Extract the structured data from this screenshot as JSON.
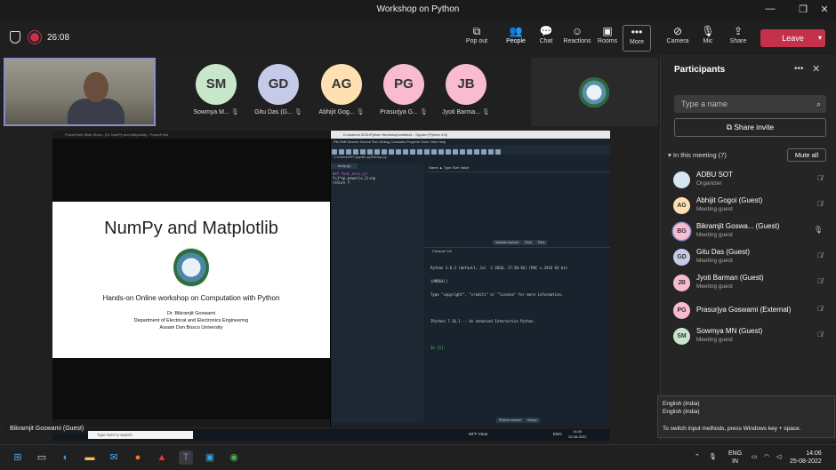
{
  "window": {
    "title": "Workshop on Python",
    "controls": [
      "—",
      "❐",
      "✕"
    ]
  },
  "toolbar": {
    "timer": "26:08",
    "buttons": [
      {
        "label": "Pop out",
        "icon": "popout-icon",
        "glyph": "⧉"
      },
      {
        "label": "People",
        "icon": "people-icon",
        "glyph": "👥"
      },
      {
        "label": "Chat",
        "icon": "chat-icon",
        "glyph": "💬"
      },
      {
        "label": "Reactions",
        "icon": "reactions-icon",
        "glyph": "☺"
      },
      {
        "label": "Rooms",
        "icon": "rooms-icon",
        "glyph": "▣"
      },
      {
        "label": "More",
        "icon": "more-icon",
        "glyph": "•••"
      },
      {
        "label": "Camera",
        "icon": "camera-off-icon",
        "glyph": "⊘"
      },
      {
        "label": "Mic",
        "icon": "mic-off-icon",
        "glyph": "🎙"
      },
      {
        "label": "Share",
        "icon": "share-icon",
        "glyph": "⇪"
      }
    ],
    "leave_label": "Leave",
    "leave_color": "#c4314b"
  },
  "gallery": [
    {
      "initials": "SM",
      "name": "Sowmya M...",
      "color": "#c8e6c9"
    },
    {
      "initials": "GD",
      "name": "Gitu Das (G...",
      "color": "#c5cae9"
    },
    {
      "initials": "AG",
      "name": "Abhijit Gog...",
      "color": "#ffe0b2"
    },
    {
      "initials": "PG",
      "name": "Prasurjya G...",
      "color": "#f8bbd0"
    },
    {
      "initials": "JB",
      "name": "Jyoti Barma...",
      "color": "#f8bbd0"
    }
  ],
  "presenter_label": "Bikramjit Goswami (Guest)",
  "shared": {
    "ppt_title": "PowerPoint Slide Show - [01 NumPy and Matplotlib] - PowerPoint",
    "slide": {
      "title": "NumPy and Matplotlib",
      "subtitle": "Hands-on Online workshop on Computation with Python",
      "author_1": "Dr. Bikramjit Goswami",
      "author_2": "Department of Electrical and Electronics Engineering",
      "author_3": "Assam Don Bosco University"
    },
    "spyder_title": "D:\\Autumn 2021\\Python Workshop\\untitled1 - Spyder (Python 3.8)",
    "spyder_menu": "File  Edit  Search  Source  Run  Debug  Consoles  Projects  Tools  View  Help",
    "spyder_path": "C:\\Users\\HP\\.spyder-py3\\temp.py",
    "editor_tab": "temp.py",
    "code_1": "def func_ex(x,y):",
    "code_2": "    f=1*np.power(x,2)+np",
    "code_3": "    return f",
    "var_headers": "Name ▲   Type    Size                         Value",
    "var_tabs": [
      "Variable explorer",
      "Plots",
      "Files"
    ],
    "console_tab": "Console 1/A",
    "console_1": "Python 3.8.3 (default, Jul  2 2020, 17:30:36) [MSC v.1916 64 bit",
    "console_2": "(AMD64)]",
    "console_3": "Type \"copyright\", \"credits\" or \"license\" for more information.",
    "console_4": "IPython 7.16.1 -- An enhanced Interactive Python.",
    "console_prompt": "In [1]:",
    "console_tabs": [
      "IPython console",
      "History"
    ],
    "rdp_search": "Type here to search",
    "rdp_weather": "69°F  Clear",
    "rdp_lang": "ENG",
    "rdp_time": "14:06",
    "rdp_date": "25-08-2022"
  },
  "panel": {
    "title": "Participants",
    "search_placeholder": "Type a name",
    "share_invite": "Share invite",
    "in_meeting": "In this meeting (7)",
    "mute_all": "Mute all",
    "participants": [
      {
        "initials": "",
        "name": "ADBU SOT",
        "role": "Organizer",
        "color": "#d7e7f2",
        "mic": "muted"
      },
      {
        "initials": "AG",
        "name": "Abhijit Gogoi (Guest)",
        "role": "Meeting guest",
        "color": "#ffe0b2",
        "mic": "muted"
      },
      {
        "initials": "BG",
        "name": "Bikramjit Goswa... (Guest)",
        "role": "Meeting guest",
        "color": "#f8bbd0",
        "mic": "on"
      },
      {
        "initials": "GD",
        "name": "Gitu Das (Guest)",
        "role": "Meeting guest",
        "color": "#c5cae9",
        "mic": "muted"
      },
      {
        "initials": "JB",
        "name": "Jyoti Barman (Guest)",
        "role": "Meeting guest",
        "color": "#f8bbd0",
        "mic": "muted"
      },
      {
        "initials": "PG",
        "name": "Prasurjya Goswami (External)",
        "role": "",
        "color": "#f8bbd0",
        "mic": "muted"
      },
      {
        "initials": "SM",
        "name": "Sowmya MN (Guest)",
        "role": "Meeting guest",
        "color": "#c8e6c9",
        "mic": "muted"
      }
    ]
  },
  "ime": {
    "line_1": "English (India)",
    "line_2": "English (India)",
    "line_3": "To switch input methods, press Windows key + space."
  },
  "taskbar": {
    "lang_1": "ENG",
    "lang_2": "IN",
    "time": "14:06",
    "date": "25-08-2022"
  }
}
